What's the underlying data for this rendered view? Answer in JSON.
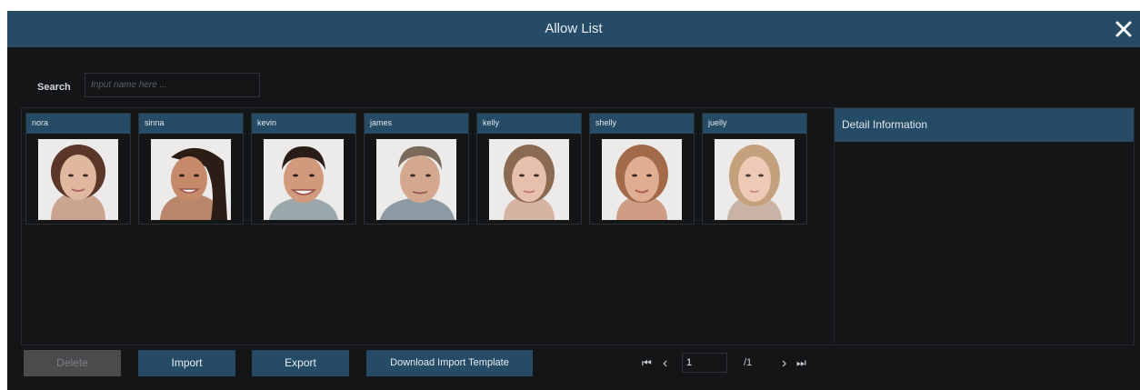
{
  "dialog": {
    "title": "Allow List"
  },
  "search": {
    "label": "Search",
    "placeholder": "Input name here ..."
  },
  "people": [
    {
      "name": "nora"
    },
    {
      "name": "sinna"
    },
    {
      "name": "kevin"
    },
    {
      "name": "james"
    },
    {
      "name": "kelly"
    },
    {
      "name": "shelly"
    },
    {
      "name": "juelly"
    }
  ],
  "detail": {
    "header": "Detail Information"
  },
  "buttons": {
    "delete": "Delete",
    "import": "Import",
    "export": "Export",
    "download_template": "Download Import Template"
  },
  "pagination": {
    "first": "⏮",
    "prev": "‹",
    "current_page": "1",
    "total": "/1",
    "next": "›",
    "last": "⏭"
  },
  "colors": {
    "accent": "#264b67",
    "background": "#131517",
    "disabled": "#494b4d"
  }
}
